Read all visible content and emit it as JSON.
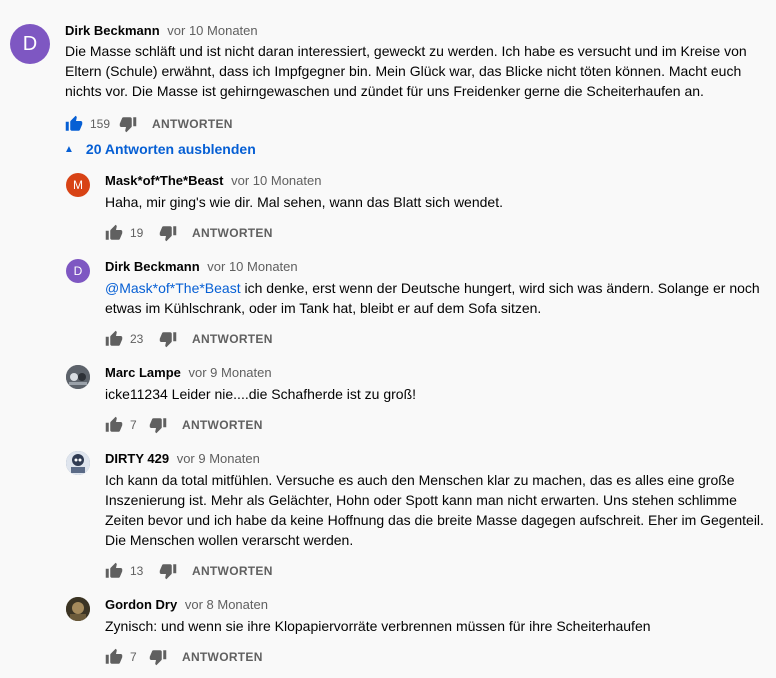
{
  "toggle_label": "20 Antworten ausblenden",
  "reply_label": "ANTWORTEN",
  "main_comment": {
    "author": "Dirk Beckmann",
    "time": "vor 10 Monaten",
    "avatar_letter": "D",
    "avatar_color": "#7e57c2",
    "lines": [
      "Die Masse schläft und ist nicht daran interessiert, geweckt zu werden. Ich habe es versucht und im Kreise von",
      "Eltern (Schule) erwähnt, dass ich Impfgegner bin. Mein Glück war, das Blicke nicht töten können. Macht euch",
      "nichts vor. Die Masse ist gehirngewaschen und zündet für uns Freidenker gerne die Scheiterhaufen an."
    ],
    "likes": "159"
  },
  "replies": [
    {
      "author": "Mask*of*The*Beast",
      "time": "vor 10 Monaten",
      "avatar_letter": "M",
      "avatar_color": "#d84315",
      "lines": [
        "Haha, mir ging's wie dir. Mal sehen, wann das Blatt sich wendet."
      ],
      "likes": "19"
    },
    {
      "author": "Dirk Beckmann",
      "time": "vor 10 Monaten",
      "avatar_letter": "D",
      "avatar_color": "#7e57c2",
      "mention": "@Mask*of*The*Beast",
      "lines": [
        " ich denke, erst wenn der Deutsche hungert, wird sich was ändern. Solange er noch",
        "etwas im Kühlschrank, oder im Tank hat, bleibt er auf dem Sofa sitzen."
      ],
      "likes": "23"
    },
    {
      "author": "Marc Lampe",
      "time": "vor 9 Monaten",
      "avatar_letter": "",
      "avatar_color": "#4a4f57",
      "lines": [
        "icke11234 Leider nie....die Schafherde ist zu groß!"
      ],
      "likes": "7"
    },
    {
      "author": "DIRTY 429",
      "time": "vor 9 Monaten",
      "avatar_letter": "",
      "avatar_color": "#6d7f97",
      "lines": [
        "Ich kann da total mitfühlen. Versuche es auch den Menschen klar zu machen, das es alles eine große",
        "Inszenierung ist. Mehr als Gelächter, Hohn oder Spott kann man nicht erwarten. Uns stehen schlimme",
        "Zeiten bevor und ich habe da keine Hoffnung das die breite Masse dagegen aufschreit. Eher im Gegenteil.",
        "Die Menschen wollen verarscht werden."
      ],
      "likes": "13"
    },
    {
      "author": "Gordon Dry",
      "time": "vor 8 Monaten",
      "avatar_letter": "",
      "avatar_color": "#5b4a2e",
      "lines": [
        "Zynisch: und wenn sie ihre Klopapiervorräte verbrennen müssen für ihre Scheiterhaufen"
      ],
      "likes": "7"
    }
  ]
}
